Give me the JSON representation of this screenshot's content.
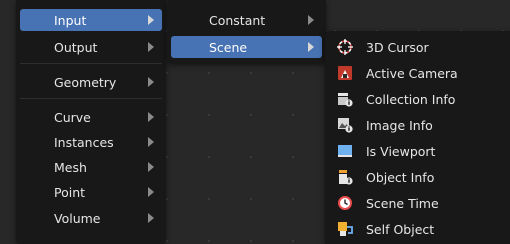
{
  "main_menu": {
    "items": [
      {
        "label": "Input",
        "submenu": true,
        "active": true
      },
      {
        "label": "Output",
        "submenu": true
      },
      {
        "label": "Geometry",
        "submenu": true
      },
      {
        "label": "Curve",
        "submenu": true
      },
      {
        "label": "Instances",
        "submenu": true
      },
      {
        "label": "Mesh",
        "submenu": true
      },
      {
        "label": "Point",
        "submenu": true
      },
      {
        "label": "Volume",
        "submenu": true
      }
    ]
  },
  "input_menu": {
    "items": [
      {
        "label": "Constant",
        "submenu": true
      },
      {
        "label": "Scene",
        "submenu": true,
        "active": true
      }
    ]
  },
  "scene_menu": {
    "items": [
      {
        "label": "3D Cursor",
        "icon": "cursor-icon"
      },
      {
        "label": "Active Camera",
        "icon": "camera-icon"
      },
      {
        "label": "Collection Info",
        "icon": "collection-info-icon"
      },
      {
        "label": "Image Info",
        "icon": "image-info-icon"
      },
      {
        "label": "Is Viewport",
        "icon": "viewport-icon"
      },
      {
        "label": "Object Info",
        "icon": "object-info-icon"
      },
      {
        "label": "Scene Time",
        "icon": "clock-icon"
      },
      {
        "label": "Self Object",
        "icon": "self-object-icon"
      }
    ]
  },
  "colors": {
    "accent": "#4772b3",
    "menu_bg": "#181818",
    "editor_bg": "#282828"
  }
}
